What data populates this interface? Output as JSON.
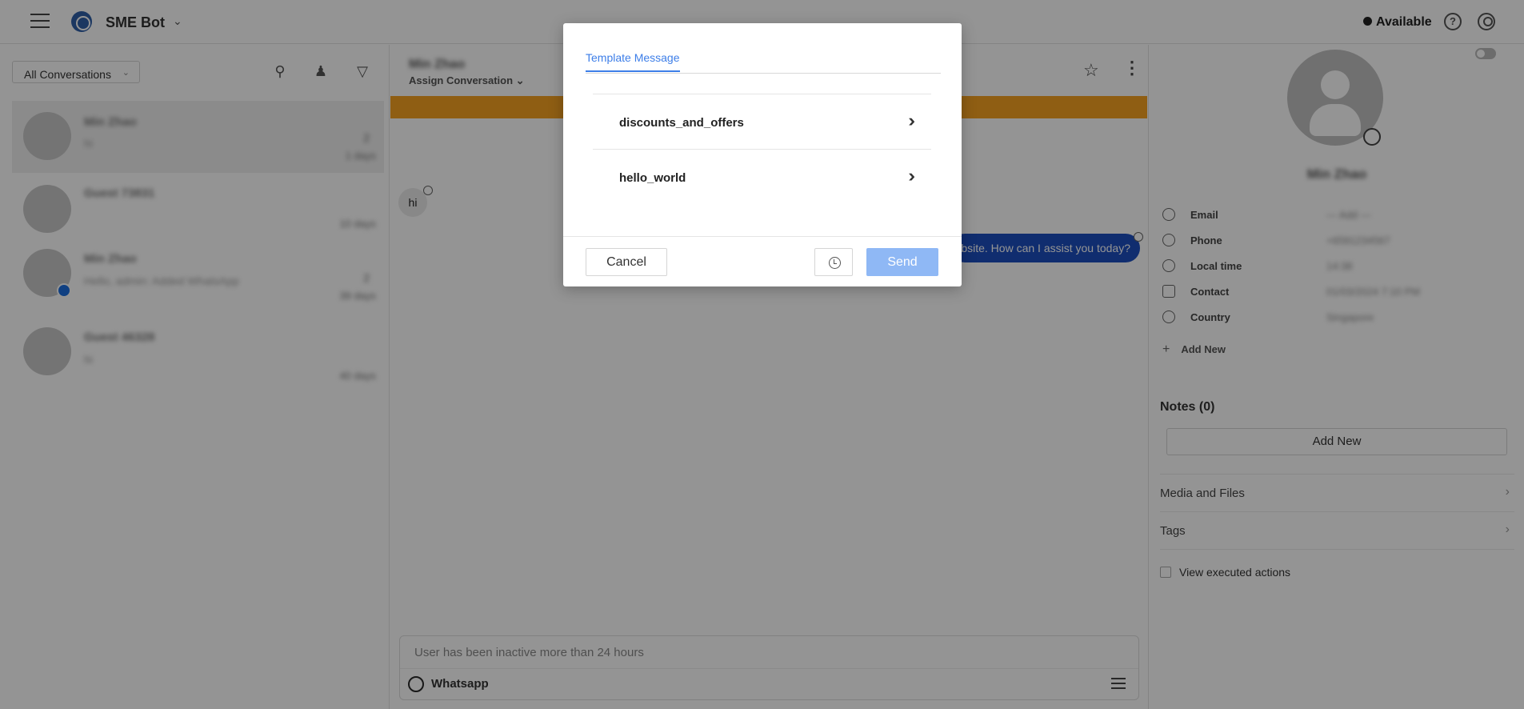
{
  "topbar": {
    "app_name": "SME Bot",
    "status": "Available"
  },
  "left": {
    "filter_label": "All Conversations",
    "conversations": [
      {
        "name": "Min Zhao",
        "message": "hi",
        "badge": "2",
        "time": "1 days"
      },
      {
        "name": "Guest 73831",
        "message": "",
        "badge": "",
        "time": "10 days"
      },
      {
        "name": "Min Zhao",
        "message": "Hello, admin: Added WhatsApp",
        "badge": "2",
        "time": "39 days"
      },
      {
        "name": "Guest 46328",
        "message": "hi",
        "badge": "",
        "time": "40 days"
      }
    ]
  },
  "chat": {
    "title": "Min Zhao",
    "assign_label": "Assign Conversation",
    "incoming_message": "hi",
    "outgoing_message": "bsite. How can I assist you today?",
    "composer_placeholder": "User has been inactive more than 24 hours",
    "channel": "Whatsapp"
  },
  "right": {
    "contact_name": "Min Zhao",
    "attributes": [
      {
        "label": "Email",
        "value": "— Add —"
      },
      {
        "label": "Phone",
        "value": "+6591234567"
      },
      {
        "label": "Local time",
        "value": "14:38"
      },
      {
        "label": "Contact",
        "value": "01/03/2024 7:10 PM"
      },
      {
        "label": "Country",
        "value": "Singapore"
      }
    ],
    "add_new_attr": "Add New",
    "notes_title": "Notes (0)",
    "notes_add": "Add New",
    "sections": [
      "Media and Files",
      "Tags"
    ],
    "executed_actions": "View executed actions"
  },
  "modal": {
    "tab": "Template Message",
    "templates": [
      "discounts_and_offers",
      "hello_world"
    ],
    "cancel": "Cancel",
    "send": "Send"
  },
  "colors": {
    "accent": "#3d7ee8",
    "outgoing_bubble": "#1d4fbf",
    "banner": "#f7a322",
    "send_disabled": "#8fb8f5"
  }
}
